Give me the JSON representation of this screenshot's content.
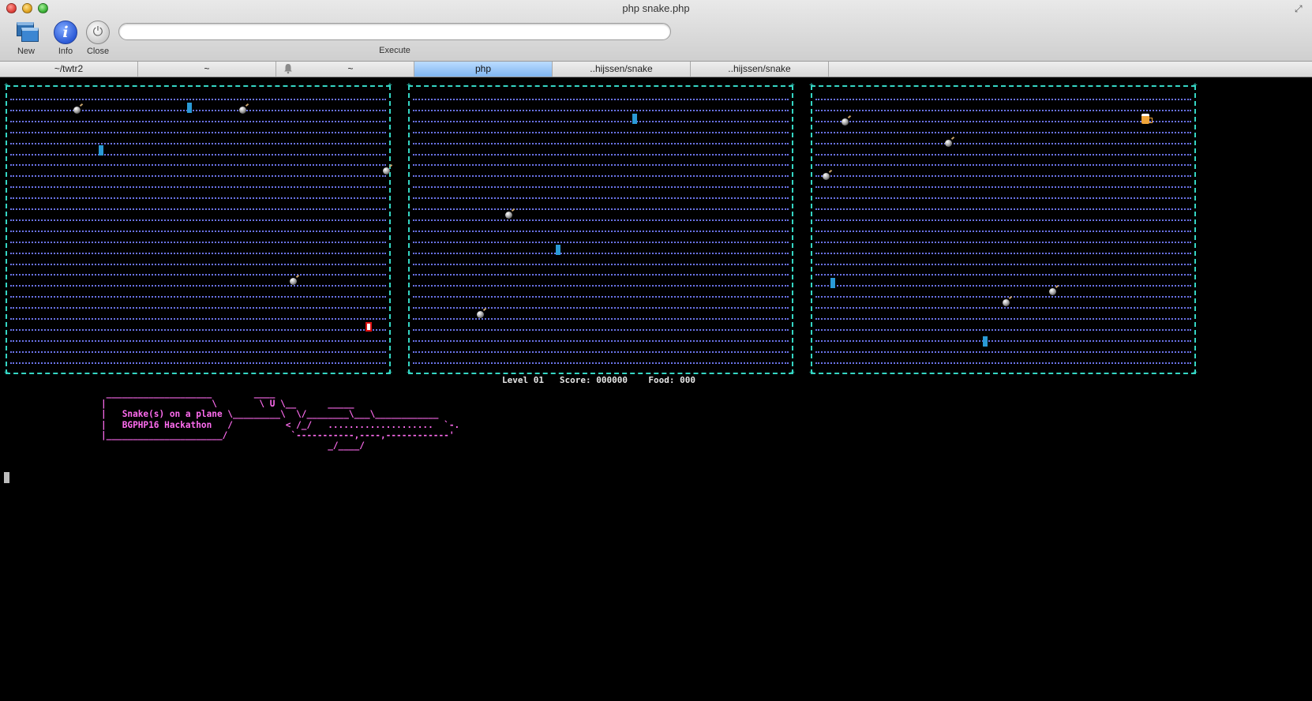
{
  "window": {
    "title": "php snake.php"
  },
  "toolbar": {
    "new_label": "New",
    "info_label": "Info",
    "close_label": "Close",
    "command_value": "",
    "execute_label": "Execute"
  },
  "tabs": [
    {
      "label": "~/twtr2",
      "active": false
    },
    {
      "label": "~",
      "active": false
    },
    {
      "label": "~",
      "active": false,
      "icon": "bell-icon"
    },
    {
      "label": "php",
      "active": true
    },
    {
      "label": "..hijssen/snake",
      "active": false
    },
    {
      "label": "..hijssen/snake",
      "active": false
    }
  ],
  "game": {
    "status_line": "Level 01   Score: 000000    Food: 000",
    "level": "01",
    "score": "000000",
    "food": "000",
    "boards": [
      {
        "food_icon": "bomb-icon",
        "snake_icon": "snake-segment-icon"
      },
      {
        "food_icon": "bomb-icon",
        "snake_icon": "snake-segment-icon"
      },
      {
        "food_icon": "bomb-icon",
        "snake_icon": "snake-segment-icon",
        "bonus_icon": "beer-mug-icon"
      }
    ],
    "banner": " ____________________        ____\n|                    \\        \\ U \\__      _____\n|   Snake(s) on a plane \\_________\\  \\/________\\___\\____________\n|   BGPHP16 Hackathon   /          < /_/   ....................  `-.\n|______________________/            `-----------,----,------------'\n                                           _/____/"
  },
  "colors": {
    "board_border": "#34d6c4",
    "grid_dots": "#6a73e8",
    "snake": "#2a9ad6",
    "banner": "#ff6cf0",
    "active_tab": "#7fb6f1"
  }
}
